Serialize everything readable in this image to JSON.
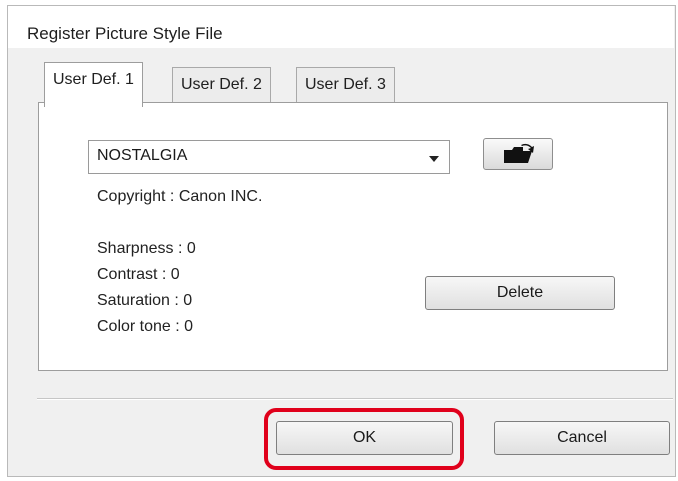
{
  "window": {
    "title": "Register Picture Style File"
  },
  "tabs": [
    {
      "label": "User Def. 1",
      "active": true
    },
    {
      "label": "User Def. 2",
      "active": false
    },
    {
      "label": "User Def. 3",
      "active": false
    }
  ],
  "style_select": {
    "value": "NOSTALGIA"
  },
  "open_file_button": {
    "icon": "folder-open-icon"
  },
  "copyright": "Copyright : Canon INC.",
  "params": {
    "sharpness": "Sharpness : 0",
    "contrast": "Contrast : 0",
    "saturation": "Saturation : 0",
    "color_tone": "Color tone : 0"
  },
  "buttons": {
    "delete": "Delete",
    "ok": "OK",
    "cancel": "Cancel"
  },
  "highlight": {
    "color": "#e0001b",
    "target": "ok-button"
  }
}
